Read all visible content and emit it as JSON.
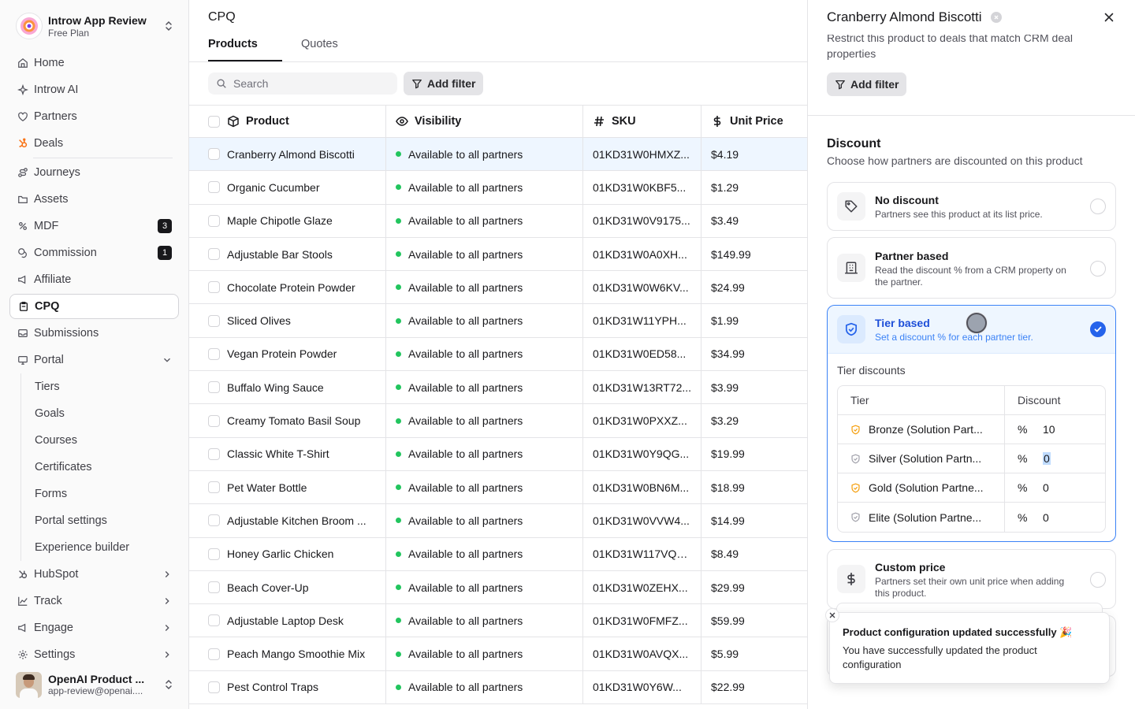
{
  "workspace": {
    "name": "Introw App Review",
    "plan": "Free Plan"
  },
  "sidebar": {
    "items": [
      {
        "label": "Home",
        "icon": "home-icon"
      },
      {
        "label": "Introw AI",
        "icon": "sparkle-icon"
      },
      {
        "label": "Partners",
        "icon": "handshake-icon"
      },
      {
        "label": "Deals",
        "icon": "hubspot-icon"
      },
      {
        "label": "Journeys",
        "icon": "route-icon"
      },
      {
        "label": "Assets",
        "icon": "folder-icon"
      },
      {
        "label": "MDF",
        "icon": "percent-icon",
        "badge": "3"
      },
      {
        "label": "Commission",
        "icon": "coins-icon",
        "badge": "1"
      },
      {
        "label": "Affiliate",
        "icon": "megaphone-icon"
      },
      {
        "label": "CPQ",
        "icon": "clipboard-icon",
        "active": true
      },
      {
        "label": "Submissions",
        "icon": "inbox-icon"
      },
      {
        "label": "Portal",
        "icon": "monitor-icon"
      }
    ],
    "portal_sub": [
      "Tiers",
      "Goals",
      "Courses",
      "Certificates",
      "Forms",
      "Portal settings",
      "Experience builder"
    ],
    "bottom_items": [
      {
        "label": "HubSpot",
        "icon": "hubspot-icon"
      },
      {
        "label": "Track",
        "icon": "chart-icon"
      },
      {
        "label": "Engage",
        "icon": "megaphone-icon"
      },
      {
        "label": "Settings",
        "icon": "gear-icon"
      }
    ]
  },
  "user": {
    "name": "OpenAI Product ...",
    "email": "app-review@openai...."
  },
  "main": {
    "title": "CPQ",
    "tabs": [
      "Products",
      "Quotes"
    ],
    "search_placeholder": "Search",
    "add_filter": "Add filter",
    "columns": [
      "Product",
      "Visibility",
      "SKU",
      "Unit Price"
    ],
    "rows": [
      {
        "product": "Cranberry Almond Biscotti",
        "visibility": "Available to all partners",
        "sku": "01KD31W0HMXZ...",
        "price": "$4.19"
      },
      {
        "product": "Organic Cucumber",
        "visibility": "Available to all partners",
        "sku": "01KD31W0KBF5...",
        "price": "$1.29"
      },
      {
        "product": "Maple Chipotle Glaze",
        "visibility": "Available to all partners",
        "sku": "01KD31W0V9175...",
        "price": "$3.49"
      },
      {
        "product": "Adjustable Bar Stools",
        "visibility": "Available to all partners",
        "sku": "01KD31W0A0XH...",
        "price": "$149.99"
      },
      {
        "product": "Chocolate Protein Powder",
        "visibility": "Available to all partners",
        "sku": "01KD31W0W6KV...",
        "price": "$24.99"
      },
      {
        "product": "Sliced Olives",
        "visibility": "Available to all partners",
        "sku": "01KD31W11YPH...",
        "price": "$1.99"
      },
      {
        "product": "Vegan Protein Powder",
        "visibility": "Available to all partners",
        "sku": "01KD31W0ED58...",
        "price": "$34.99"
      },
      {
        "product": "Buffalo Wing Sauce",
        "visibility": "Available to all partners",
        "sku": "01KD31W13RT72...",
        "price": "$3.99"
      },
      {
        "product": "Creamy Tomato Basil Soup",
        "visibility": "Available to all partners",
        "sku": "01KD31W0PXXZ...",
        "price": "$3.29"
      },
      {
        "product": "Classic White T-Shirt",
        "visibility": "Available to all partners",
        "sku": "01KD31W0Y9QG...",
        "price": "$19.99"
      },
      {
        "product": "Pet Water Bottle",
        "visibility": "Available to all partners",
        "sku": "01KD31W0BN6M...",
        "price": "$18.99"
      },
      {
        "product": "Adjustable Kitchen Broom ...",
        "visibility": "Available to all partners",
        "sku": "01KD31W0VVW4...",
        "price": "$14.99"
      },
      {
        "product": "Honey Garlic Chicken",
        "visibility": "Available to all partners",
        "sku": "01KD31W117VQB...",
        "price": "$8.49"
      },
      {
        "product": "Beach Cover-Up",
        "visibility": "Available to all partners",
        "sku": "01KD31W0ZEHX...",
        "price": "$29.99"
      },
      {
        "product": "Adjustable Laptop Desk",
        "visibility": "Available to all partners",
        "sku": "01KD31W0FMFZ...",
        "price": "$59.99"
      },
      {
        "product": "Peach Mango Smoothie Mix",
        "visibility": "Available to all partners",
        "sku": "01KD31W0AVQX...",
        "price": "$5.99"
      },
      {
        "product": "Pest Control Traps",
        "visibility": "Available to all partners",
        "sku": "01KD31W0Y6W...",
        "price": "$22.99"
      }
    ]
  },
  "panel": {
    "title": "Cranberry Almond Biscotti",
    "restrict_text": "Restrict this product to deals that match CRM deal properties",
    "add_filter": "Add filter",
    "discount_title": "Discount",
    "discount_sub": "Choose how partners are discounted on this product",
    "options": [
      {
        "title": "No discount",
        "desc": "Partners see this product at its list price."
      },
      {
        "title": "Partner based",
        "desc": "Read the discount % from a CRM property on the partner."
      },
      {
        "title": "Tier based",
        "desc": "Set a discount % for each partner tier."
      },
      {
        "title": "Custom price",
        "desc": "Partners set their own unit price when adding this product."
      }
    ],
    "tier_label": "Tier discounts",
    "tier_columns": [
      "Tier",
      "Discount"
    ],
    "tiers": [
      {
        "name": "Bronze (Solution Part...",
        "pct": "%",
        "value": "10",
        "color": "#f59e0b"
      },
      {
        "name": "Silver (Solution Partn...",
        "pct": "%",
        "value": "0",
        "color": "#a1a1aa"
      },
      {
        "name": "Gold (Solution Partne...",
        "pct": "%",
        "value": "0",
        "color": "#f59e0b"
      },
      {
        "name": "Elite (Solution Partne...",
        "pct": "%",
        "value": "0",
        "color": "#a1a1aa"
      }
    ]
  },
  "toast": {
    "title": "Product configuration updated successfully 🎉",
    "desc": "You have successfully updated the product configuration"
  }
}
